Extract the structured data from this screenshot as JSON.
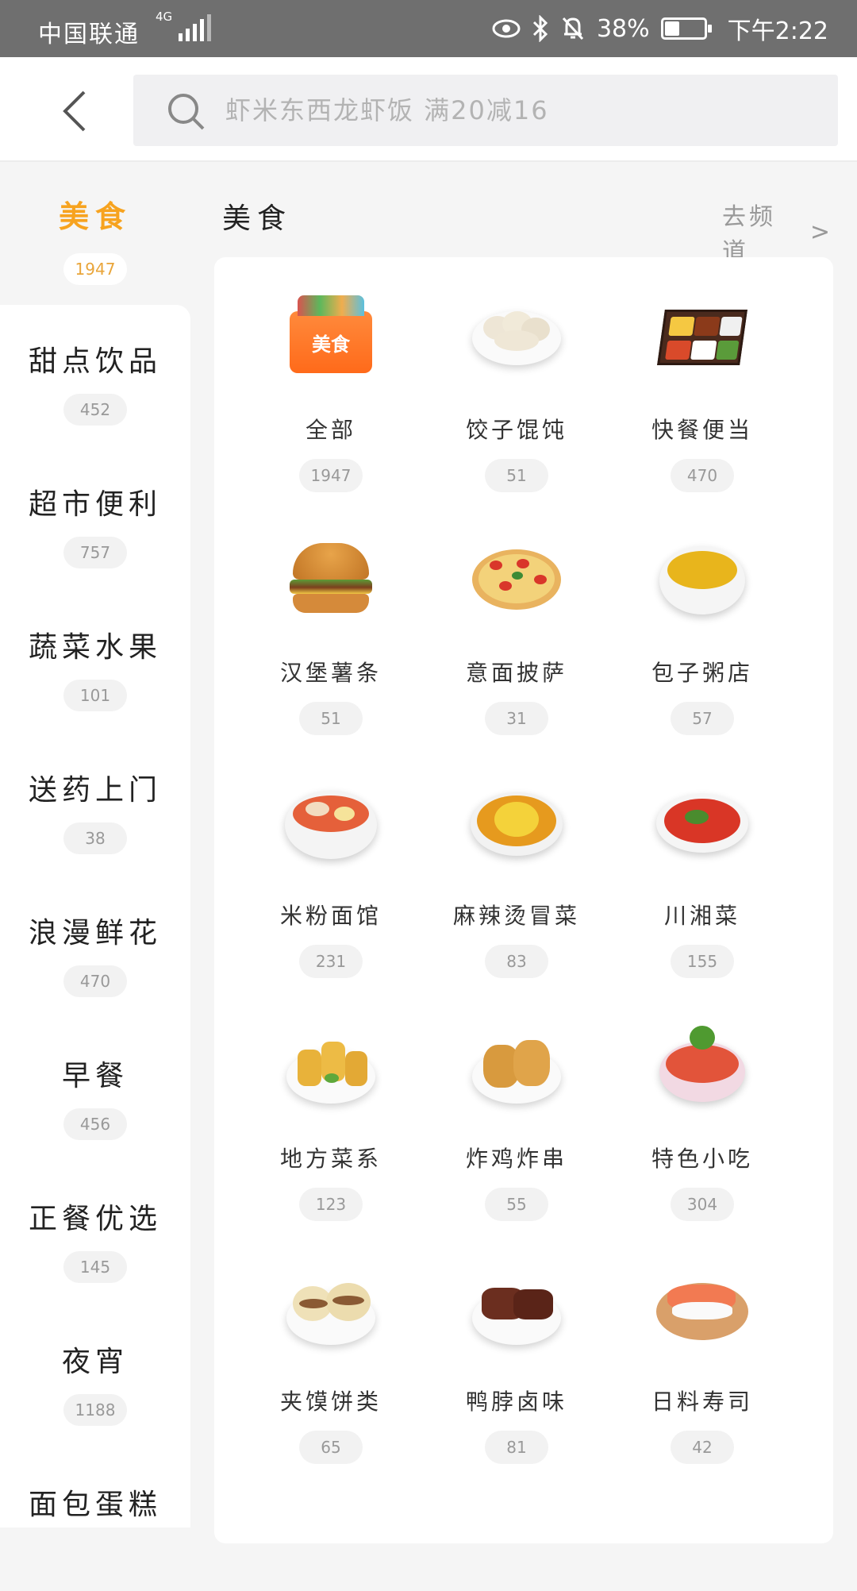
{
  "status_bar": {
    "carrier": "中国联通",
    "network": "4G",
    "battery": "38%",
    "battery_level": 0.38,
    "time": "下午2:22"
  },
  "header": {
    "search_placeholder": "虾米东西龙虾饭 满20减16"
  },
  "sidebar": {
    "active": {
      "label": "美食",
      "count": "1947"
    },
    "items": [
      {
        "label": "甜点饮品",
        "count": "452"
      },
      {
        "label": "超市便利",
        "count": "757"
      },
      {
        "label": "蔬菜水果",
        "count": "101"
      },
      {
        "label": "送药上门",
        "count": "38"
      },
      {
        "label": "浪漫鲜花",
        "count": "470"
      },
      {
        "label": "早餐",
        "count": "456"
      },
      {
        "label": "正餐优选",
        "count": "145"
      },
      {
        "label": "夜宵",
        "count": "1188"
      },
      {
        "label": "面包蛋糕",
        "count": ""
      }
    ]
  },
  "main": {
    "section_title": "美食",
    "channel_link": "去频道",
    "channel_arrow": ">",
    "badge_all": "美食",
    "categories": [
      {
        "label": "全部",
        "count": "1947",
        "icon": "food-bag-icon"
      },
      {
        "label": "饺子馄饨",
        "count": "51",
        "icon": "dumplings-icon"
      },
      {
        "label": "快餐便当",
        "count": "470",
        "icon": "bento-icon"
      },
      {
        "label": "汉堡薯条",
        "count": "51",
        "icon": "burger-icon"
      },
      {
        "label": "意面披萨",
        "count": "31",
        "icon": "pizza-icon"
      },
      {
        "label": "包子粥店",
        "count": "57",
        "icon": "porridge-icon"
      },
      {
        "label": "米粉面馆",
        "count": "231",
        "icon": "noodles-icon"
      },
      {
        "label": "麻辣烫冒菜",
        "count": "83",
        "icon": "malatang-icon"
      },
      {
        "label": "川湘菜",
        "count": "155",
        "icon": "sichuan-dish-icon"
      },
      {
        "label": "地方菜系",
        "count": "123",
        "icon": "spring-rolls-icon"
      },
      {
        "label": "炸鸡炸串",
        "count": "55",
        "icon": "fried-chicken-icon"
      },
      {
        "label": "特色小吃",
        "count": "304",
        "icon": "snack-bowl-icon"
      },
      {
        "label": "夹馍饼类",
        "count": "65",
        "icon": "roujiamo-icon"
      },
      {
        "label": "鸭脖卤味",
        "count": "81",
        "icon": "braised-duck-icon"
      },
      {
        "label": "日料寿司",
        "count": "42",
        "icon": "sushi-icon"
      }
    ]
  },
  "colors": {
    "accent": "#f7a31f",
    "status_bar": "#6f6f6f"
  }
}
